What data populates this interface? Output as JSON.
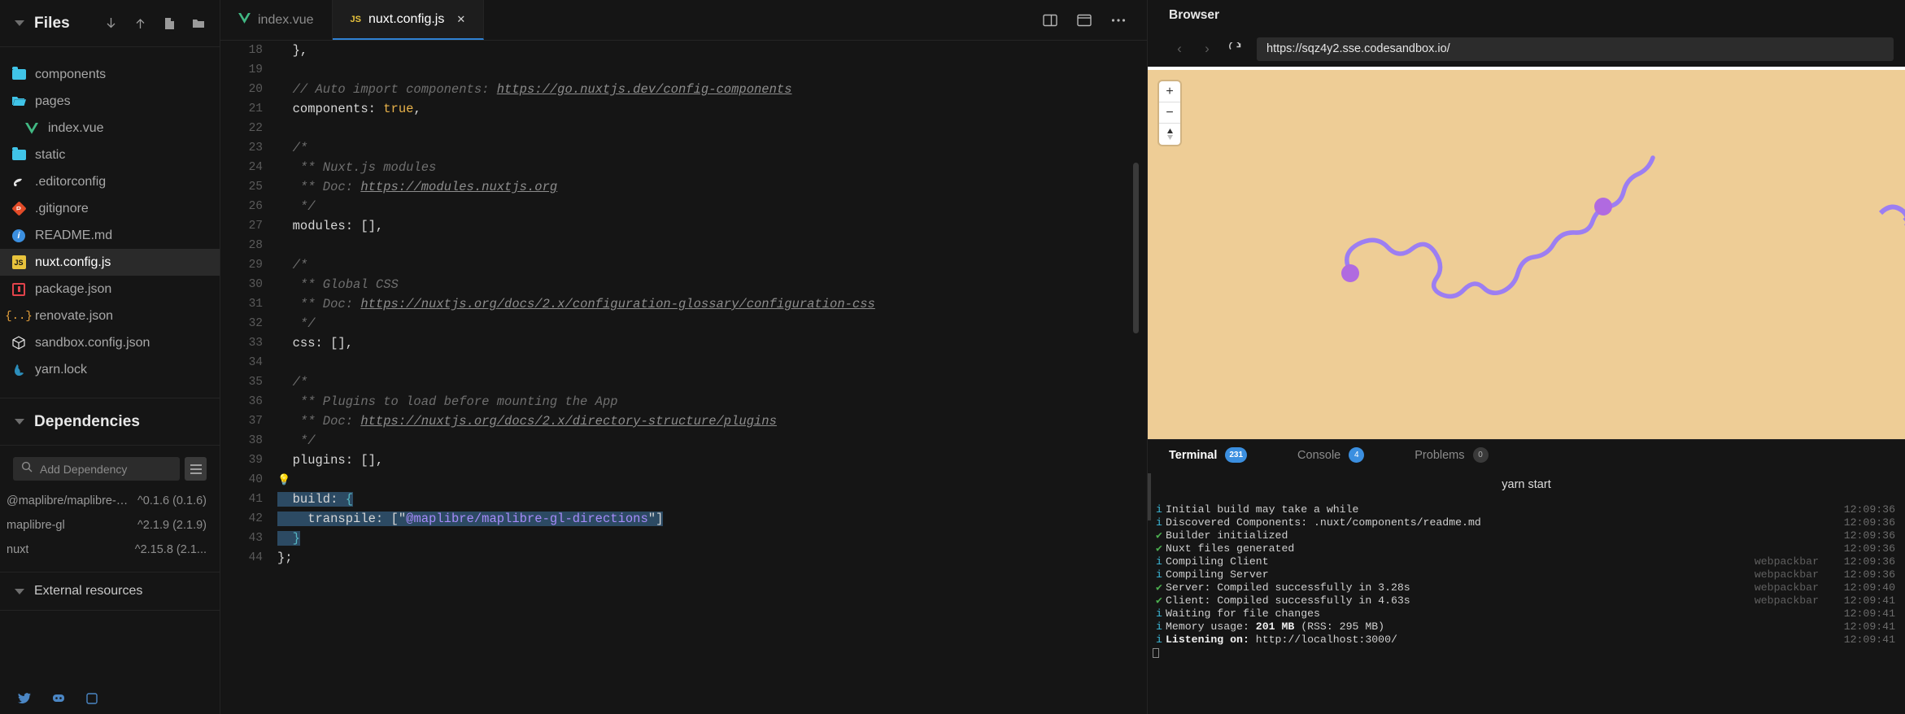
{
  "sidebar": {
    "files_title": "Files",
    "files_actions": [
      {
        "name": "download-icon",
        "glyph": "↓"
      },
      {
        "name": "upload-icon",
        "glyph": "↑"
      },
      {
        "name": "new-file-icon",
        "glyph": "❐"
      },
      {
        "name": "new-folder-icon",
        "glyph": "▮"
      }
    ],
    "files": [
      {
        "label": "components",
        "icon": "folder-icon",
        "indent": 0,
        "active": false
      },
      {
        "label": "pages",
        "icon": "folder-open-icon",
        "indent": 0,
        "active": false
      },
      {
        "label": "index.vue",
        "icon": "vue-icon",
        "indent": 1,
        "active": false
      },
      {
        "label": "static",
        "icon": "folder-icon",
        "indent": 0,
        "active": false
      },
      {
        "label": ".editorconfig",
        "icon": "editorconfig-icon",
        "indent": 0,
        "active": false
      },
      {
        "label": ".gitignore",
        "icon": "git-icon",
        "indent": 0,
        "active": false
      },
      {
        "label": "README.md",
        "icon": "markdown-icon",
        "indent": 0,
        "active": false
      },
      {
        "label": "nuxt.config.js",
        "icon": "js-icon",
        "indent": 0,
        "active": true
      },
      {
        "label": "package.json",
        "icon": "package-icon",
        "indent": 0,
        "active": false
      },
      {
        "label": "renovate.json",
        "icon": "renovate-icon",
        "indent": 0,
        "active": false
      },
      {
        "label": "sandbox.config.json",
        "icon": "sandbox-icon",
        "indent": 0,
        "active": false
      },
      {
        "label": "yarn.lock",
        "icon": "yarn-icon",
        "indent": 0,
        "active": false
      }
    ],
    "dependencies_title": "Dependencies",
    "dep_search_placeholder": "Add Dependency",
    "dep_search_value": "",
    "dependencies": [
      {
        "name": "@maplibre/maplibre-gl-...",
        "version": "^0.1.6 (0.1.6)"
      },
      {
        "name": "maplibre-gl",
        "version": "^2.1.9 (2.1.9)"
      },
      {
        "name": "nuxt",
        "version": "^2.15.8 (2.1..."
      }
    ],
    "external_resources_title": "External resources"
  },
  "editor": {
    "tabs": [
      {
        "label": "index.vue",
        "icon": "vue-icon",
        "active": false,
        "closable": false
      },
      {
        "label": "nuxt.config.js",
        "icon": "js-icon",
        "active": true,
        "closable": true
      }
    ],
    "close_glyph": "✕",
    "toolbar_icons": [
      {
        "name": "split-editor-icon"
      },
      {
        "name": "preview-pane-icon"
      },
      {
        "name": "more-options-icon",
        "glyph": "•••"
      }
    ],
    "lines": [
      {
        "n": 18,
        "segments": [
          {
            "t": "plain",
            "v": "  },"
          }
        ]
      },
      {
        "n": 19,
        "segments": []
      },
      {
        "n": 20,
        "segments": [
          {
            "t": "comment",
            "v": "  // Auto import components: "
          },
          {
            "t": "link",
            "v": "https://go.nuxtjs.dev/config-components"
          }
        ]
      },
      {
        "n": 21,
        "segments": [
          {
            "t": "key",
            "v": "  components: "
          },
          {
            "t": "bool",
            "v": "true"
          },
          {
            "t": "punc",
            "v": ","
          }
        ]
      },
      {
        "n": 22,
        "segments": []
      },
      {
        "n": 23,
        "segments": [
          {
            "t": "comment",
            "v": "  /*"
          }
        ]
      },
      {
        "n": 24,
        "segments": [
          {
            "t": "comment",
            "v": "   ** Nuxt.js modules"
          }
        ]
      },
      {
        "n": 25,
        "segments": [
          {
            "t": "comment",
            "v": "   ** Doc: "
          },
          {
            "t": "link",
            "v": "https://modules.nuxtjs.org"
          }
        ]
      },
      {
        "n": 26,
        "segments": [
          {
            "t": "comment",
            "v": "   */"
          }
        ]
      },
      {
        "n": 27,
        "segments": [
          {
            "t": "key",
            "v": "  modules: []"
          },
          {
            "t": "punc",
            "v": ","
          }
        ]
      },
      {
        "n": 28,
        "segments": []
      },
      {
        "n": 29,
        "segments": [
          {
            "t": "comment",
            "v": "  /*"
          }
        ]
      },
      {
        "n": 30,
        "segments": [
          {
            "t": "comment",
            "v": "   ** Global CSS"
          }
        ]
      },
      {
        "n": 31,
        "segments": [
          {
            "t": "comment",
            "v": "   ** Doc: "
          },
          {
            "t": "link",
            "v": "https://nuxtjs.org/docs/2.x/configuration-glossary/configuration-css"
          }
        ]
      },
      {
        "n": 32,
        "segments": [
          {
            "t": "comment",
            "v": "   */"
          }
        ]
      },
      {
        "n": 33,
        "segments": [
          {
            "t": "key",
            "v": "  css: []"
          },
          {
            "t": "punc",
            "v": ","
          }
        ]
      },
      {
        "n": 34,
        "segments": []
      },
      {
        "n": 35,
        "segments": [
          {
            "t": "comment",
            "v": "  /*"
          }
        ]
      },
      {
        "n": 36,
        "segments": [
          {
            "t": "comment",
            "v": "   ** Plugins to load before mounting the App"
          }
        ]
      },
      {
        "n": 37,
        "segments": [
          {
            "t": "comment",
            "v": "   ** Doc: "
          },
          {
            "t": "link",
            "v": "https://nuxtjs.org/docs/2.x/directory-structure/plugins"
          }
        ]
      },
      {
        "n": 38,
        "segments": [
          {
            "t": "comment",
            "v": "   */"
          }
        ]
      },
      {
        "n": 39,
        "segments": [
          {
            "t": "key",
            "v": "  plugins: []"
          },
          {
            "t": "punc",
            "v": ","
          }
        ]
      },
      {
        "n": 40,
        "segments": [
          {
            "t": "bulb",
            "v": "💡"
          }
        ]
      },
      {
        "n": 41,
        "segments": [
          {
            "t": "sel-key",
            "v": "  build: "
          },
          {
            "t": "sel-brace",
            "v": "{"
          }
        ]
      },
      {
        "n": 42,
        "segments": [
          {
            "t": "sel-key",
            "v": "    transpile: [\""
          },
          {
            "t": "sel-str",
            "v": "@maplibre/maplibre-gl-directions"
          },
          {
            "t": "sel-key",
            "v": "\"]"
          }
        ]
      },
      {
        "n": 43,
        "segments": [
          {
            "t": "sel-brace",
            "v": "  }"
          }
        ]
      },
      {
        "n": 44,
        "segments": [
          {
            "t": "plain",
            "v": "};"
          }
        ]
      }
    ]
  },
  "browser": {
    "title": "Browser",
    "back_glyph": "‹",
    "forward_glyph": "›",
    "reload_glyph": "⟳",
    "url": "https://sqz4y2.sse.codesandbox.io/",
    "map_controls": [
      {
        "name": "zoom-in-button",
        "glyph": "+"
      },
      {
        "name": "zoom-out-button",
        "glyph": "−"
      },
      {
        "name": "compass-button",
        "glyph": "▲"
      }
    ]
  },
  "terminal": {
    "tabs": [
      {
        "label": "Terminal",
        "badge": "231",
        "active": true,
        "badge_style": "blue"
      },
      {
        "label": "Console",
        "badge": "4",
        "active": false,
        "badge_style": "blue"
      },
      {
        "label": "Problems",
        "badge": "0",
        "active": false,
        "badge_style": "grey"
      }
    ],
    "command": "yarn start",
    "lines": [
      {
        "icon": "i",
        "msg": "Initial build may take a while",
        "source": "",
        "time": "12:09:36"
      },
      {
        "icon": "i",
        "msg": "Discovered Components: .nuxt/components/readme.md",
        "source": "",
        "time": "12:09:36"
      },
      {
        "icon": "ok",
        "msg": "Builder initialized",
        "source": "",
        "time": "12:09:36"
      },
      {
        "icon": "ok",
        "msg": "Nuxt files generated",
        "source": "",
        "time": "12:09:36"
      },
      {
        "icon": "i",
        "msg": "Compiling Client",
        "source": "webpackbar",
        "time": "12:09:36"
      },
      {
        "icon": "i",
        "msg": "Compiling Server",
        "source": "webpackbar",
        "time": "12:09:36"
      },
      {
        "icon": "ok",
        "msg": "Server: Compiled successfully in 3.28s",
        "source": "webpackbar",
        "time": "12:09:40"
      },
      {
        "icon": "ok",
        "msg": "Client: Compiled successfully in 4.63s",
        "source": "webpackbar",
        "time": "12:09:41"
      },
      {
        "icon": "i",
        "msg": "Waiting for file changes",
        "source": "",
        "time": "12:09:41"
      },
      {
        "icon": "i",
        "msg": "Memory usage: 201 MB (RSS: 295 MB)",
        "source": "",
        "time": "12:09:41",
        "bold_prefix": "Memory usage: ",
        "bold_part": "201 MB"
      },
      {
        "icon": "i",
        "msg": "Listening on: http://localhost:3000/",
        "source": "",
        "time": "12:09:41",
        "bold_part": "Listening on:"
      }
    ]
  },
  "colors": {
    "accent": "#3b8fe0",
    "map_bg": "#eecd96",
    "route": "#a06cf0",
    "selection": "#2c4a63",
    "success": "#4caf50"
  }
}
